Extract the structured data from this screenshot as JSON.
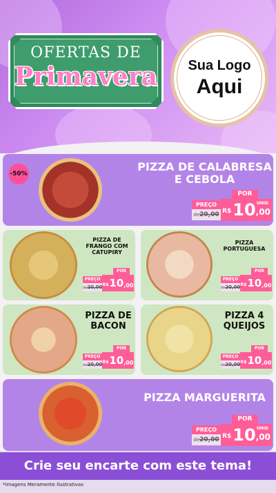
{
  "header": {
    "title_line1": "OFERTAS DE",
    "title_line2": "Primavera",
    "logo_line1": "Sua Logo",
    "logo_line2": "Aqui"
  },
  "colors": {
    "purple": "#b384e8",
    "green": "#cfe6c2",
    "pink": "#ff5d97",
    "footer": "#8a4fd6"
  },
  "discount_badge": "-50%",
  "items": [
    {
      "name_line1": "PIZZA DE CALABRESA",
      "name_line2": "E CEBOLA",
      "por": "POR",
      "preco": "PREÇO",
      "de": "de",
      "old_price": "20,00",
      "currency": "R$",
      "price_int": "10",
      "price_dec": ",00",
      "unit": "UNID"
    },
    {
      "name_line1": "PIZZA DE",
      "name_line2": "FRANGO COM",
      "name_line3": "CATUPIRY",
      "por": "POR",
      "preco": "PREÇO",
      "de": "de",
      "old_price": "20,00",
      "currency": "R$",
      "price_int": "10",
      "price_dec": ",00",
      "unit": "UNID"
    },
    {
      "name_line1": "PIZZA",
      "name_line2": "PORTUGUESA",
      "por": "POR",
      "preco": "PREÇO",
      "de": "de",
      "old_price": "20,00",
      "currency": "R$",
      "price_int": "10",
      "price_dec": ",00",
      "unit": "UNID"
    },
    {
      "name_line1": "PIZZA DE",
      "name_line2": "BACON",
      "por": "POR",
      "preco": "PREÇO",
      "de": "de",
      "old_price": "20,00",
      "currency": "R$",
      "price_int": "10",
      "price_dec": ",00",
      "unit": "UNID"
    },
    {
      "name_line1": "PIZZA 4",
      "name_line2": "QUEIJOS",
      "por": "POR",
      "preco": "PREÇO",
      "de": "de",
      "old_price": "20,00",
      "currency": "R$",
      "price_int": "10",
      "price_dec": ",00",
      "unit": "UNID"
    },
    {
      "name_line1": "PIZZA MARGUERITA",
      "por": "POR",
      "preco": "PREÇO",
      "de": "de",
      "old_price": "20,00",
      "currency": "R$",
      "price_int": "10",
      "price_dec": ",00",
      "unit": "UNID"
    }
  ],
  "footer": {
    "cta": "Crie seu encarte com este tema!",
    "note": "*Imagens Meramente Ilustrativas"
  }
}
